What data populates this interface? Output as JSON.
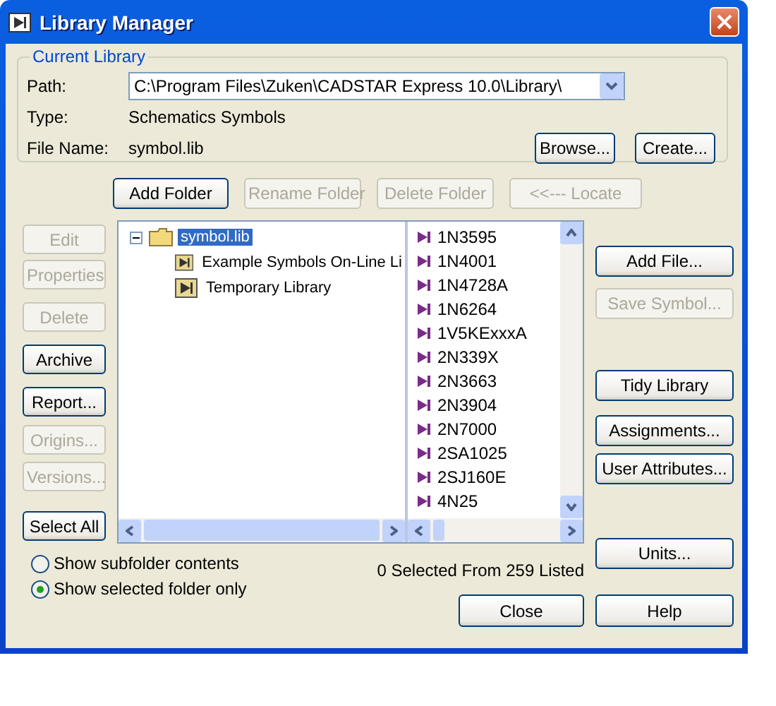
{
  "window": {
    "title": "Library Manager"
  },
  "current_library": {
    "title": "Current Library",
    "path_label": "Path:",
    "path": "C:\\Program Files\\Zuken\\CADSTAR Express 10.0\\Library\\",
    "type_label": "Type:",
    "type": "Schematics Symbols",
    "file_name_label": "File Name:",
    "file_name": "symbol.lib",
    "buttons": [
      {
        "label": "Browse...",
        "disabled": false
      },
      {
        "label": "Create...",
        "disabled": false
      }
    ]
  },
  "folder_buttons": [
    {
      "label": "Add Folder",
      "disabled": false
    },
    {
      "label": "Rename Folder",
      "disabled": true
    },
    {
      "label": "Delete Folder",
      "disabled": true
    },
    {
      "label": "<<--- Locate",
      "disabled": true
    }
  ],
  "left_buttons": [
    {
      "label": "Edit",
      "disabled": true
    },
    {
      "label": "Properties",
      "disabled": true
    },
    {
      "label": "Delete",
      "disabled": true
    },
    {
      "label": "Archive",
      "disabled": false
    },
    {
      "label": "Report...",
      "disabled": false
    },
    {
      "label": "Origins...",
      "disabled": true
    },
    {
      "label": "Versions...",
      "disabled": true
    },
    {
      "label": "Select All",
      "disabled": false
    }
  ],
  "tree": {
    "items": [
      {
        "label": "symbol.lib",
        "selected": true,
        "expanded": true,
        "children": [
          {
            "label": "Example Symbols On-Line Li",
            "selected": false
          },
          {
            "label": "Temporary Library",
            "selected": false
          }
        ]
      }
    ]
  },
  "symbols": [
    "1N3595",
    "1N4001",
    "1N4728A",
    "1N6264",
    "1V5KExxxA",
    "2N339X",
    "2N3663",
    "2N3904",
    "2N7000",
    "2SA1025",
    "2SJ160E",
    "4N25"
  ],
  "right_buttons": [
    {
      "label": "Add File...",
      "disabled": false
    },
    {
      "label": "Save Symbol...",
      "disabled": true
    },
    {
      "label": "Tidy Library",
      "disabled": false
    },
    {
      "label": "Assignments...",
      "disabled": false
    },
    {
      "label": "User Attributes...",
      "disabled": false
    },
    {
      "label": "Units...",
      "disabled": false
    }
  ],
  "options": [
    {
      "label": "Show subfolder contents",
      "selected": false
    },
    {
      "label": "Show selected folder only",
      "selected": true
    }
  ],
  "status": "0 Selected From 259 Listed",
  "bottom_buttons": [
    {
      "label": "Close",
      "disabled": false
    },
    {
      "label": "Help",
      "disabled": false
    }
  ]
}
